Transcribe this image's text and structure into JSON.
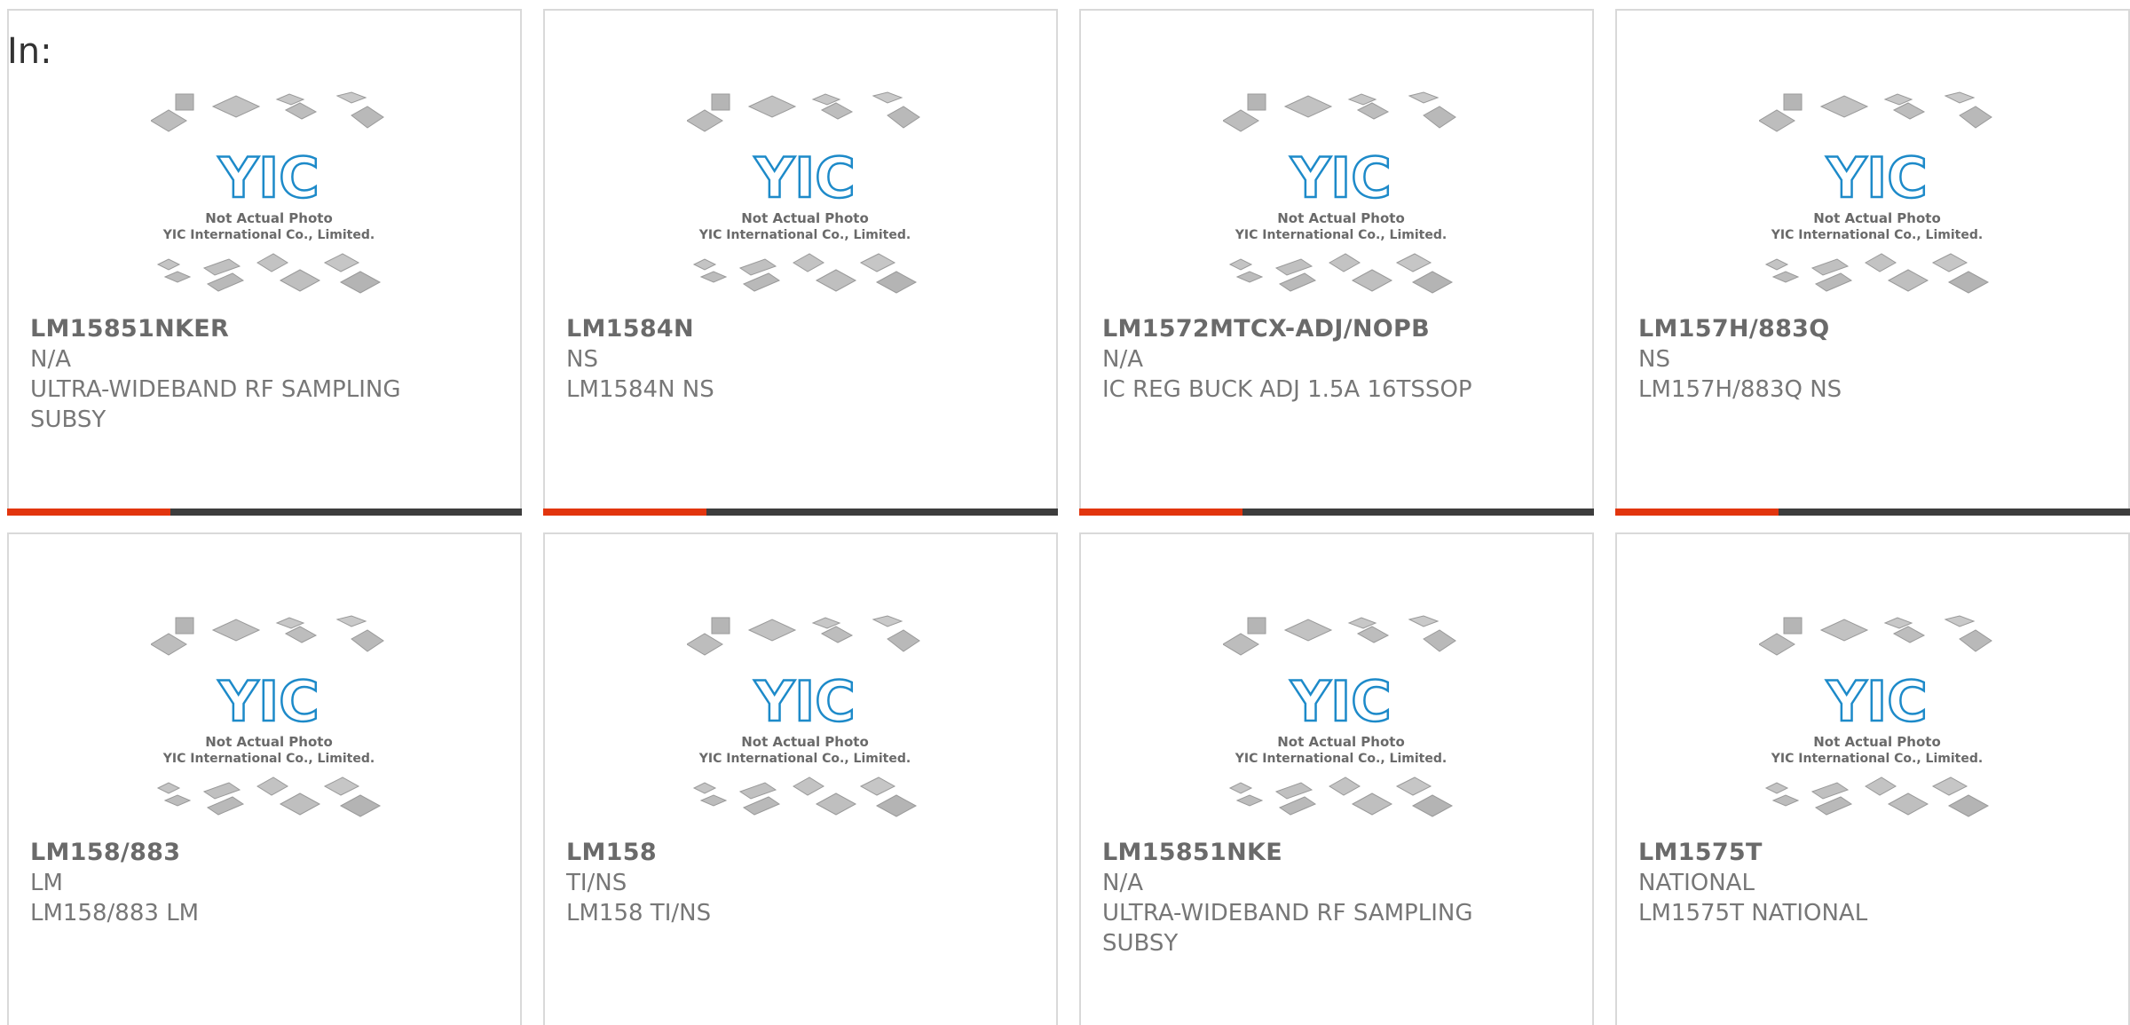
{
  "header": {
    "label": "In:"
  },
  "placeholder": {
    "line1": "Not Actual Photo",
    "line2": "YIC International Co., Limited.",
    "logo_text": "YIC"
  },
  "colors": {
    "accent": "#e2350e",
    "bar": "#3d3d3d",
    "logo": "#1d8ac9",
    "border": "#d9d9d9"
  },
  "products": [
    {
      "part": "LM15851NKER",
      "mfr": "N/A",
      "desc": "ULTRA-WIDEBAND RF SAMPLING SUBSY"
    },
    {
      "part": "LM1584N",
      "mfr": "NS",
      "desc": "LM1584N NS"
    },
    {
      "part": "LM1572MTCX-ADJ/NOPB",
      "mfr": "N/A",
      "desc": "IC REG BUCK ADJ 1.5A 16TSSOP"
    },
    {
      "part": "LM157H/883Q",
      "mfr": "NS",
      "desc": "LM157H/883Q NS"
    },
    {
      "part": "LM158/883",
      "mfr": "LM",
      "desc": "LM158/883 LM"
    },
    {
      "part": "LM158",
      "mfr": "TI/NS",
      "desc": "LM158 TI/NS"
    },
    {
      "part": "LM15851NKE",
      "mfr": "N/A",
      "desc": "ULTRA-WIDEBAND RF SAMPLING SUBSY"
    },
    {
      "part": "LM1575T",
      "mfr": "NATIONAL",
      "desc": "LM1575T NATIONAL"
    }
  ]
}
